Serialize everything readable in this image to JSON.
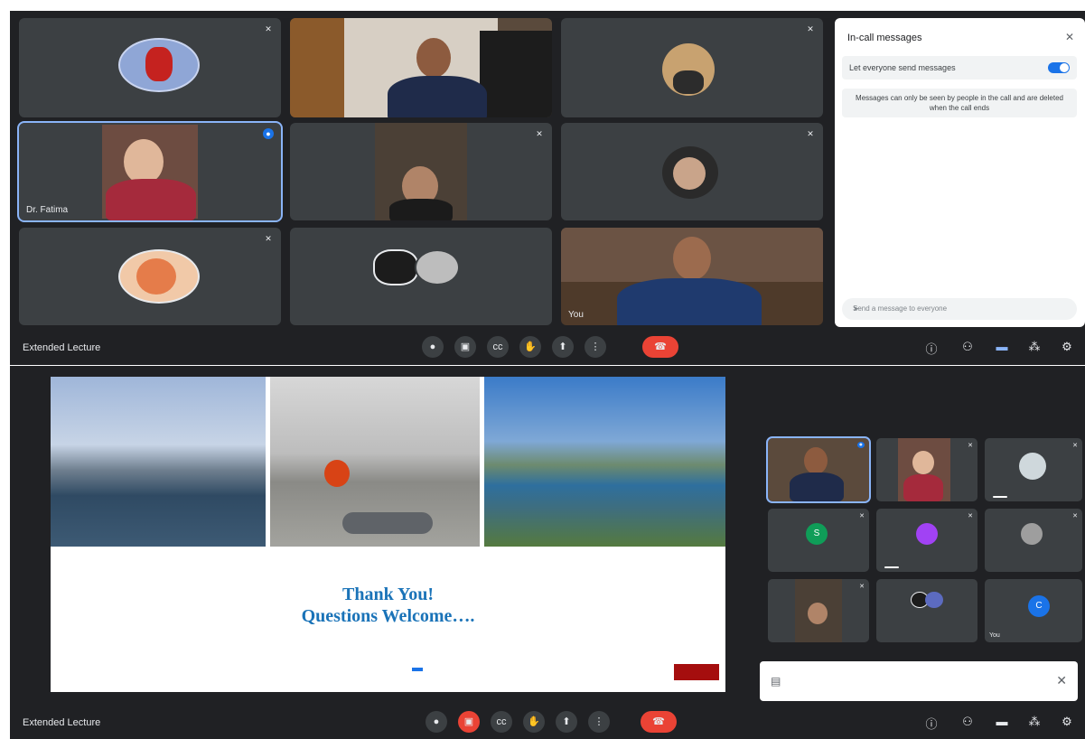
{
  "colors": {
    "accent": "#1a73e8",
    "danger": "#ea4335",
    "surface": "#3c4043",
    "background": "#202124"
  },
  "top": {
    "tiles": [
      {
        "name": "",
        "mic": "muted"
      },
      {
        "name": "",
        "mic": ""
      },
      {
        "name": "",
        "mic": "muted"
      },
      {
        "name": "Dr. Fatima",
        "mic": "speaking"
      },
      {
        "name": "",
        "mic": "muted"
      },
      {
        "name": "",
        "mic": "muted"
      },
      {
        "name": "",
        "mic": "muted"
      },
      {
        "name": "",
        "mic": ""
      },
      {
        "name": "You",
        "mic": ""
      }
    ],
    "others_label": "",
    "panel": {
      "title": "In-call messages",
      "toggle_label": "Let everyone send messages",
      "notice": "Messages can only be seen by people in the call and are deleted when the call ends",
      "messages": [
        {
          "sender": "",
          "text": ""
        },
        {
          "sender": "",
          "text": ""
        },
        {
          "sender": "",
          "text": ""
        },
        {
          "sender": "",
          "text": ""
        },
        {
          "sender": "",
          "text": ""
        }
      ],
      "input_placeholder": "Send a message to everyone"
    },
    "bar": {
      "time": "",
      "title": "Extended Lecture",
      "participants_badge": ""
    }
  },
  "bottom": {
    "slide": {
      "captions": [
        "",
        "",
        ""
      ],
      "thanks_line1": "Thank You!",
      "thanks_line2": "Questions Welcome….",
      "disclaimer_label": "",
      "disclaimer_text": "",
      "share_text": "",
      "stop_label": "",
      "hide_label": ""
    },
    "small_tiles": [
      {
        "name": ""
      },
      {
        "name": ""
      },
      {
        "name": ""
      },
      {
        "name": ""
      },
      {
        "name": ""
      },
      {
        "name": ""
      },
      {
        "name": ""
      },
      {
        "name": ""
      },
      {
        "name": "You"
      }
    ],
    "toast": {
      "text": "",
      "action": ""
    },
    "bar": {
      "time": "",
      "title": "Extended Lecture"
    }
  }
}
